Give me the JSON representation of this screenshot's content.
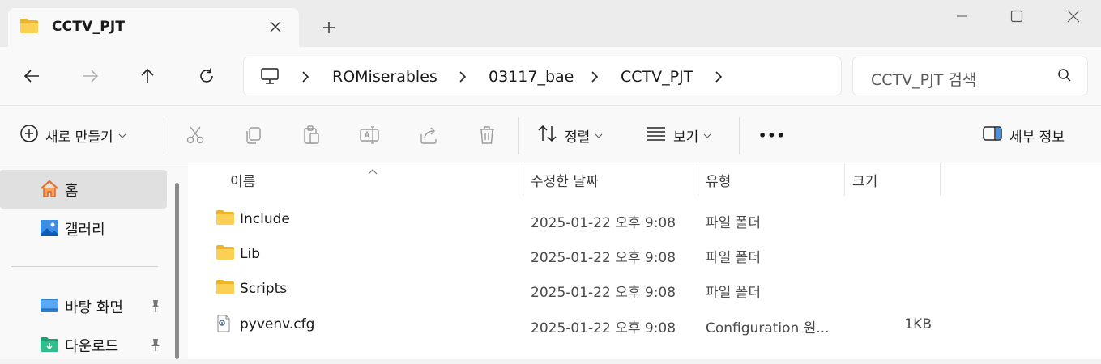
{
  "window": {
    "tab_title": "CCTV_PJT",
    "new_tab_symbol": "+",
    "accent_folder": "#f8c94a"
  },
  "address": {
    "crumbs": [
      "ROMiserables",
      "03117_bae",
      "CCTV_PJT"
    ]
  },
  "search": {
    "placeholder": "CCTV_PJT 검색"
  },
  "toolbar": {
    "new_label": "새로 만들기",
    "sort_label": "정렬",
    "view_label": "보기",
    "more_label": "•••",
    "details_label": "세부 정보"
  },
  "sidebar": {
    "items": [
      {
        "label": "홈",
        "icon": "home-icon"
      },
      {
        "label": "갤러리",
        "icon": "gallery-icon"
      },
      {
        "label": "바탕 화면",
        "icon": "desktop-folder-icon"
      },
      {
        "label": "다운로드",
        "icon": "downloads-folder-icon"
      }
    ]
  },
  "columns": {
    "name": "이름",
    "modified": "수정한 날짜",
    "type": "유형",
    "size": "크기"
  },
  "files": [
    {
      "name": "Include",
      "date": "2025-01-22 오후 9:08",
      "type": "파일 폴더",
      "size": "",
      "icon": "folder-icon"
    },
    {
      "name": "Lib",
      "date": "2025-01-22 오후 9:08",
      "type": "파일 폴더",
      "size": "",
      "icon": "folder-icon"
    },
    {
      "name": "Scripts",
      "date": "2025-01-22 오후 9:08",
      "type": "파일 폴더",
      "size": "",
      "icon": "folder-icon"
    },
    {
      "name": "pyvenv.cfg",
      "date": "2025-01-22 오후 9:08",
      "type": "Configuration 원...",
      "size": "1KB",
      "icon": "config-file-icon"
    }
  ]
}
